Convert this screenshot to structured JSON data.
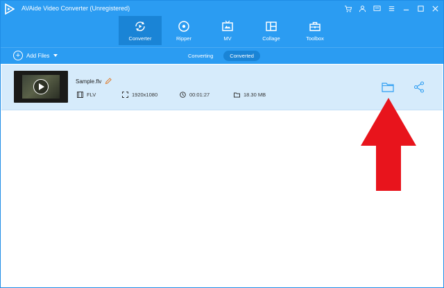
{
  "window": {
    "title": "AVAide Video Converter (Unregistered)",
    "controls": [
      "cart-icon",
      "user-icon",
      "feedback-icon",
      "menu-icon",
      "minimize-icon",
      "maximize-icon",
      "close-icon"
    ]
  },
  "tabs": [
    {
      "label": "Converter",
      "icon": "converter-icon",
      "active": true
    },
    {
      "label": "Ripper",
      "icon": "ripper-icon",
      "active": false
    },
    {
      "label": "MV",
      "icon": "mv-icon",
      "active": false
    },
    {
      "label": "Collage",
      "icon": "collage-icon",
      "active": false
    },
    {
      "label": "Toolbox",
      "icon": "toolbox-icon",
      "active": false
    }
  ],
  "subbar": {
    "add_files": "Add Files",
    "segments": [
      {
        "label": "Converting",
        "active": false
      },
      {
        "label": "Converted",
        "active": true
      }
    ]
  },
  "file": {
    "name": "Sample.flv",
    "format": "FLV",
    "resolution": "1920x1080",
    "duration": "00:01:27",
    "size": "18.30 MB"
  },
  "colors": {
    "header_bg": "#2b9cf2",
    "active_tab": "#1a84d6",
    "row_bg": "#d6ebfb",
    "annotation_arrow": "#e8141c"
  }
}
